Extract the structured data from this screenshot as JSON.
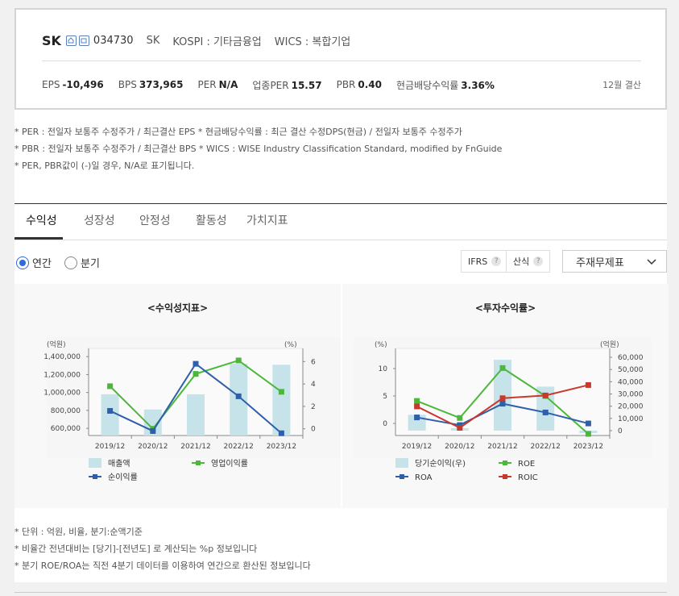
{
  "summary": {
    "name": "SK",
    "code": "034730",
    "short_name": "SK",
    "kospi": "KOSPI : 기타금융업",
    "wics": "WICS : 복합기업",
    "metrics": [
      {
        "label": "EPS",
        "value": "-10,496"
      },
      {
        "label": "BPS",
        "value": "373,965"
      },
      {
        "label": "PER",
        "value": "N/A"
      },
      {
        "label": "업종PER",
        "value": "15.57"
      },
      {
        "label": "PBR",
        "value": "0.40"
      },
      {
        "label": "현금배당수익률",
        "value": "3.36%"
      }
    ],
    "settlement": "12월 결산"
  },
  "notes": [
    "* PER : 전일자 보통주 수정주가 / 최근결산 EPS * 현금배당수익률 : 최근 결산 수정DPS(현금) / 전일자 보통주 수정주가",
    "* PBR : 전일자 보통주 수정주가 / 최근결산 BPS * WICS : WISE Industry Classification Standard, modified by FnGuide",
    "* PER, PBR값이 (-)일 경우, N/A로 표기됩니다."
  ],
  "tabs": [
    "수익성",
    "성장성",
    "안정성",
    "활동성",
    "가치지표"
  ],
  "controls": {
    "period_annual": "연간",
    "period_quarter": "분기",
    "ifrs": "IFRS",
    "calc": "산식",
    "q_mark": "?",
    "statement": "주재무제표"
  },
  "footnotes": [
    "* 단위 : 억원, 비율, 분기:순액기준",
    "* 비율간 전년대비는 [당기]-[전년도] 로 계산되는 %p 정보입니다",
    "* 분기 ROE/ROA는 직전 4분기 데이터를 이용하여 연간으로 환산된 정보입니다"
  ],
  "chart_data": [
    {
      "type": "bar",
      "title": "<수익성지표>",
      "categories": [
        "2019/12",
        "2020/12",
        "2021/12",
        "2022/12",
        "2023/12"
      ],
      "left_unit": "(억원)",
      "right_unit": "(%)",
      "left_ticks": [
        "1,400,000",
        "1,200,000",
        "1,000,000",
        "800,000",
        "600,000"
      ],
      "left_tick_values": [
        1400000,
        1200000,
        1000000,
        800000,
        600000
      ],
      "right_ticks": [
        "6",
        "4",
        "2",
        "0"
      ],
      "right_tick_values": [
        6,
        4,
        2,
        0
      ],
      "ylim_left": [
        520000,
        1420000
      ],
      "ylim_right": [
        -0.6,
        6.6
      ],
      "series": [
        {
          "name": "매출액",
          "kind": "bar",
          "axis": "left",
          "color": "#c6e3ea",
          "values": [
            980000,
            810000,
            980000,
            1320000,
            1310000
          ]
        },
        {
          "name": "영업이익률",
          "kind": "line",
          "axis": "right",
          "color": "#4cb83a",
          "values": [
            3.8,
            0.0,
            4.9,
            6.1,
            3.3
          ]
        },
        {
          "name": "순이익률",
          "kind": "line",
          "axis": "right",
          "color": "#2f5fab",
          "values": [
            1.6,
            -0.2,
            5.8,
            2.9,
            -0.4
          ]
        }
      ],
      "legend_columns": 2,
      "legend": "bottom"
    },
    {
      "type": "bar",
      "title": "<투자수익률>",
      "categories": [
        "2019/12",
        "2020/12",
        "2021/12",
        "2022/12",
        "2023/12"
      ],
      "left_unit": "(%)",
      "right_unit": "(억원)",
      "left_ticks": [
        "10",
        "5",
        "0"
      ],
      "left_tick_values": [
        10,
        5,
        0
      ],
      "right_ticks": [
        "60,000",
        "50,000",
        "40,000",
        "30,000",
        "20,000",
        "10,000",
        "0"
      ],
      "right_tick_values": [
        60000,
        50000,
        40000,
        30000,
        20000,
        10000,
        0
      ],
      "ylim_left": [
        -2.2,
        12.5
      ],
      "ylim_right": [
        -4000,
        62000
      ],
      "series": [
        {
          "name": "당기순이익(우)",
          "kind": "bar",
          "axis": "right",
          "color": "#c6e3ea",
          "values": [
            13000,
            2000,
            58000,
            36000,
            -2000
          ]
        },
        {
          "name": "ROE",
          "kind": "line",
          "axis": "left",
          "color": "#4cb83a",
          "values": [
            4.1,
            1.0,
            10.1,
            5.0,
            -1.9
          ]
        },
        {
          "name": "ROA",
          "kind": "line",
          "axis": "left",
          "color": "#2f5fab",
          "values": [
            1.1,
            -0.3,
            3.6,
            2.0,
            0.0
          ]
        },
        {
          "name": "ROIC",
          "kind": "line",
          "axis": "left",
          "color": "#c8382d",
          "values": [
            3.1,
            -0.8,
            4.6,
            5.1,
            7.0
          ]
        }
      ],
      "legend_columns": 2,
      "legend": "bottom"
    }
  ]
}
